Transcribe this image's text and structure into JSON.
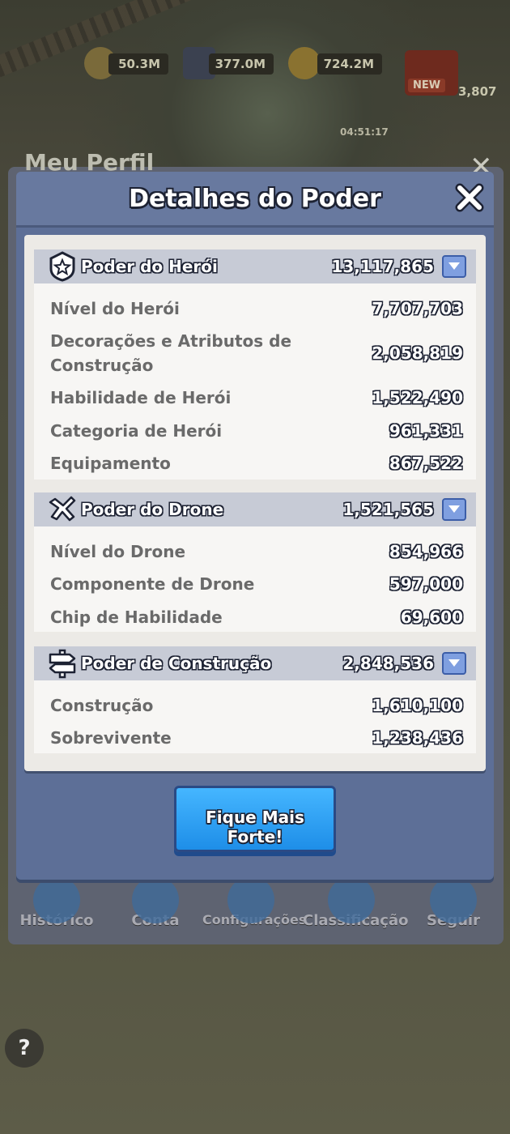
{
  "hud": {
    "resource_1": "50.3M",
    "resource_2": "377.0M",
    "resource_3": "724.2M",
    "new_badge": "NEW",
    "gem_count": "3,807",
    "timer": "04:51:17"
  },
  "profile": {
    "title": "Meu Perfil",
    "nav": [
      "Histórico",
      "Conta",
      "Configurações",
      "Classificação",
      "Seguir"
    ]
  },
  "modal": {
    "title": "Detalhes do Poder",
    "sections": [
      {
        "title": "Poder do Herói",
        "total": "13,117,865",
        "icon": "hero-badge-icon",
        "rows": [
          {
            "label": "Nível do Herói",
            "value": "7,707,703"
          },
          {
            "label": "Decorações e Atributos de Construção",
            "value": "2,058,819"
          },
          {
            "label": "Habilidade de Herói",
            "value": "1,522,490"
          },
          {
            "label": "Categoria de Herói",
            "value": "961,331"
          },
          {
            "label": "Equipamento",
            "value": "867,522"
          }
        ]
      },
      {
        "title": "Poder do Drone",
        "total": "1,521,565",
        "icon": "drone-icon",
        "rows": [
          {
            "label": "Nível do Drone",
            "value": "854,966"
          },
          {
            "label": "Componente de Drone",
            "value": "597,000"
          },
          {
            "label": "Chip de Habilidade",
            "value": "69,600"
          }
        ]
      },
      {
        "title": "Poder de Construção",
        "total": "2,848,536",
        "icon": "signpost-icon",
        "rows": [
          {
            "label": "Construção",
            "value": "1,610,100"
          },
          {
            "label": "Sobrevivente",
            "value": "1,238,436"
          }
        ]
      }
    ],
    "cta_label": "Fique Mais Forte!"
  }
}
